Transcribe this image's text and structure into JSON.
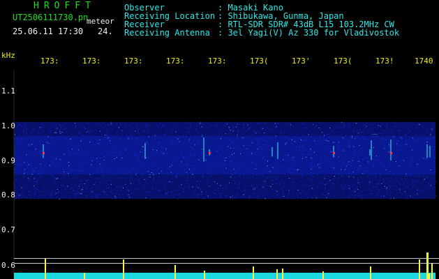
{
  "header": {
    "app_title": "HROFFT",
    "file_name": "UT2506111730.pn",
    "mode": "meteor",
    "date_time": "25.06.11 17:30",
    "count": "24.",
    "fields": [
      {
        "label": "Observer",
        "value": ": Masaki Kano"
      },
      {
        "label": "Receiving Location",
        "value": ": Shibukawa, Gunma, Japan"
      },
      {
        "label": "Receiver",
        "value": ": RTL-SDR SDR# 43dB L15 103.2MHz CW"
      },
      {
        "label": "Receiving Antenna",
        "value": ": 3el Yagi(V) Az 330 for Vladivostok"
      }
    ]
  },
  "axis": {
    "unit": "kHz",
    "y_ticks": [
      "1.1",
      "1.0",
      "0.9",
      "0.8",
      "0.7",
      "0.6"
    ],
    "time_ticks": [
      "173:",
      "173:",
      "173:",
      "173:",
      "173:",
      "173(",
      "173'",
      "173(",
      "173!",
      "1740"
    ]
  },
  "colors": {
    "background": "#000000",
    "header_green": "#18e018",
    "header_cyan": "#2ee8e8",
    "tick_yellow": "#f0f000",
    "noise_blue": "#1a2aff",
    "signal_cyan": "#30f0f0",
    "signal_red": "#ff3040"
  },
  "spectrogram": {
    "band_top_khz": 1.0,
    "band_bottom_khz": 0.8,
    "signal_center_khz": 0.92
  }
}
